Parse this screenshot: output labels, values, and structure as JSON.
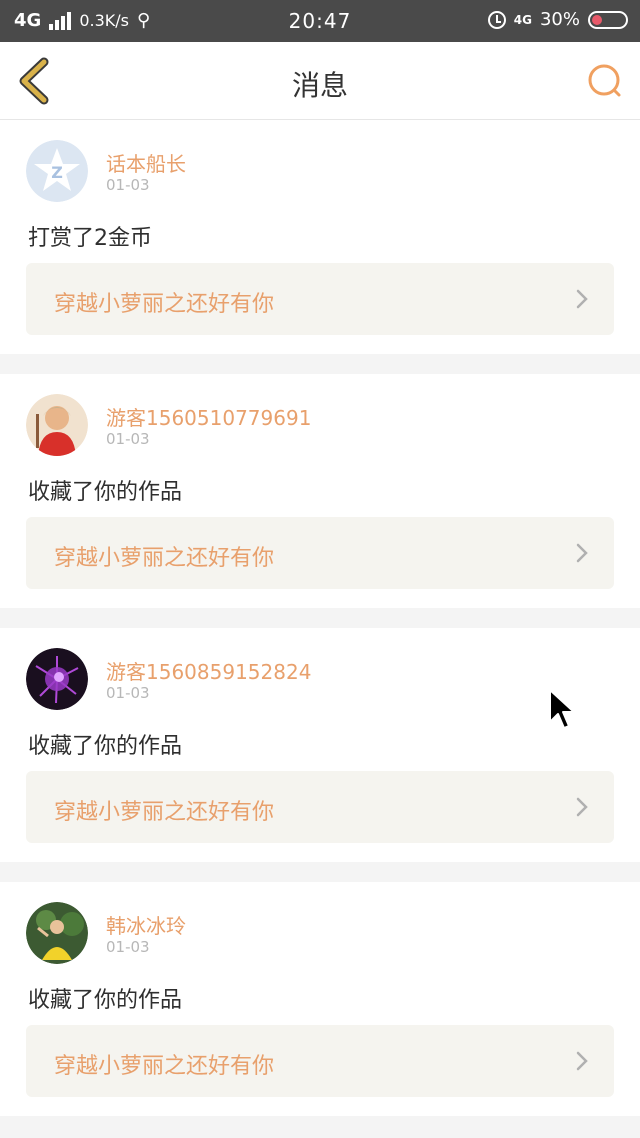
{
  "status_bar": {
    "network": "4G",
    "speed": "0.3K/s",
    "usb_symbol": "⚲",
    "time": "20:47",
    "network2": "4G",
    "battery": "30%",
    "battery_level": 0.3
  },
  "header": {
    "title": "消息",
    "back_icon": "chevron-left-icon",
    "search_icon": "search-icon"
  },
  "notifications": [
    {
      "username": "话本船长",
      "date": "01-03",
      "action": "打赏了2金币",
      "work_title": "穿越小萝丽之还好有你"
    },
    {
      "username": "游客1560510779691",
      "date": "01-03",
      "action": "收藏了你的作品",
      "work_title": "穿越小萝丽之还好有你"
    },
    {
      "username": "游客1560859152824",
      "date": "01-03",
      "action": "收藏了你的作品",
      "work_title": "穿越小萝丽之还好有你"
    },
    {
      "username": "韩冰冰玲",
      "date": "01-03",
      "action": "收藏了你的作品",
      "work_title": "穿越小萝丽之还好有你"
    }
  ],
  "colors": {
    "accent": "#e8a06c",
    "back_icon": "#d9b24a",
    "search_icon": "#f0a060",
    "statusbar": "#4a4a4a"
  }
}
